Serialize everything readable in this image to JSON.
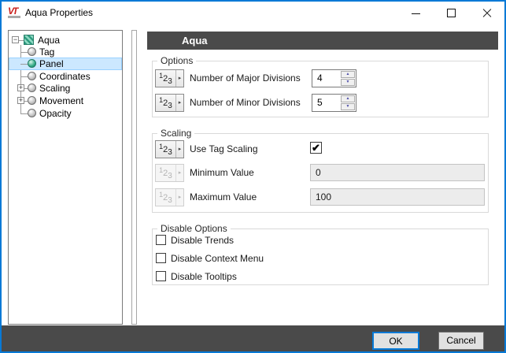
{
  "window": {
    "title": "Aqua Properties",
    "logo": "VT"
  },
  "tree": {
    "root": "Aqua",
    "items": [
      "Tag",
      "Panel",
      "Coordinates",
      "Scaling",
      "Movement",
      "Opacity"
    ],
    "selected": "Panel"
  },
  "panel": {
    "header": "Aqua",
    "options": {
      "title": "Options",
      "rows": [
        {
          "label": "Number of Major Divisions",
          "value": "4"
        },
        {
          "label": "Number of Minor Divisions",
          "value": "5"
        }
      ]
    },
    "scaling": {
      "title": "Scaling",
      "checkbox_label": "Use Tag Scaling",
      "checkbox_checked": true,
      "rows": [
        {
          "label": "Minimum Value",
          "value": "0",
          "disabled": true
        },
        {
          "label": "Maximum Value",
          "value": "100",
          "disabled": true
        }
      ]
    },
    "disable_options": {
      "title": "Disable Options",
      "items": [
        "Disable Trends",
        "Disable Context Menu",
        "Disable Tooltips"
      ],
      "checked": [
        false,
        false,
        false
      ]
    }
  },
  "footer": {
    "ok": "OK",
    "cancel": "Cancel"
  },
  "icons": {
    "expander_expanded": "−",
    "expander_collapsed": "+",
    "check": "✔",
    "dropdown_arrow": "▸",
    "spin_up": "▲",
    "spin_down": "▼"
  },
  "expr_button": {
    "d1": "1",
    "d2": "2",
    "d3": "3"
  },
  "colors": {
    "accent_blue": "#0779d6",
    "selection_bg": "#cce8ff",
    "selection_border": "#99d1ff",
    "dark_bar": "#4a4a4a",
    "logo_red": "#c9201d",
    "tag_green": "#34ab86"
  }
}
